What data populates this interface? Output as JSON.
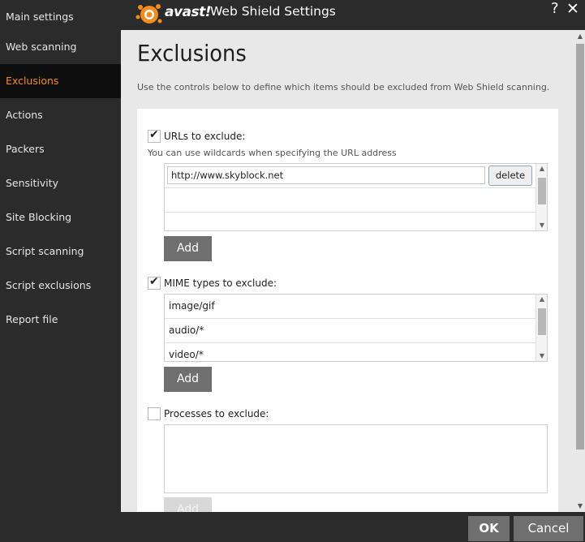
{
  "app": {
    "brand": "avast!",
    "window_title": "Web Shield Settings",
    "help_label": "?",
    "close_label": "✕"
  },
  "sidebar": {
    "items": [
      {
        "label": "Main settings"
      },
      {
        "label": "Web scanning"
      },
      {
        "label": "Exclusions"
      },
      {
        "label": "Actions"
      },
      {
        "label": "Packers"
      },
      {
        "label": "Sensitivity"
      },
      {
        "label": "Site Blocking"
      },
      {
        "label": "Script scanning"
      },
      {
        "label": "Script exclusions"
      },
      {
        "label": "Report file"
      }
    ],
    "active": "Exclusions"
  },
  "page": {
    "title": "Exclusions",
    "description": "Use the controls below to define which items should be excluded from Web Shield scanning."
  },
  "urls": {
    "checked": true,
    "label": "URLs to exclude:",
    "hint": "You can use wildcards when specifying the URL address",
    "entry_value": "http://www.skyblock.net",
    "delete_label": "delete",
    "add_label": "Add"
  },
  "mime": {
    "checked": true,
    "label": "MIME types to exclude:",
    "items": [
      "image/gif",
      "audio/*",
      "video/*"
    ],
    "add_label": "Add"
  },
  "processes": {
    "checked": false,
    "label": "Processes to exclude:",
    "add_label": "Add"
  },
  "footer": {
    "ok_label": "OK",
    "cancel_label": "Cancel"
  },
  "colors": {
    "accent": "#f28c1e",
    "sidebar_bg": "#2b2b2b",
    "active_bg": "#0f0f0f",
    "button_bg": "#6f6f6f"
  }
}
